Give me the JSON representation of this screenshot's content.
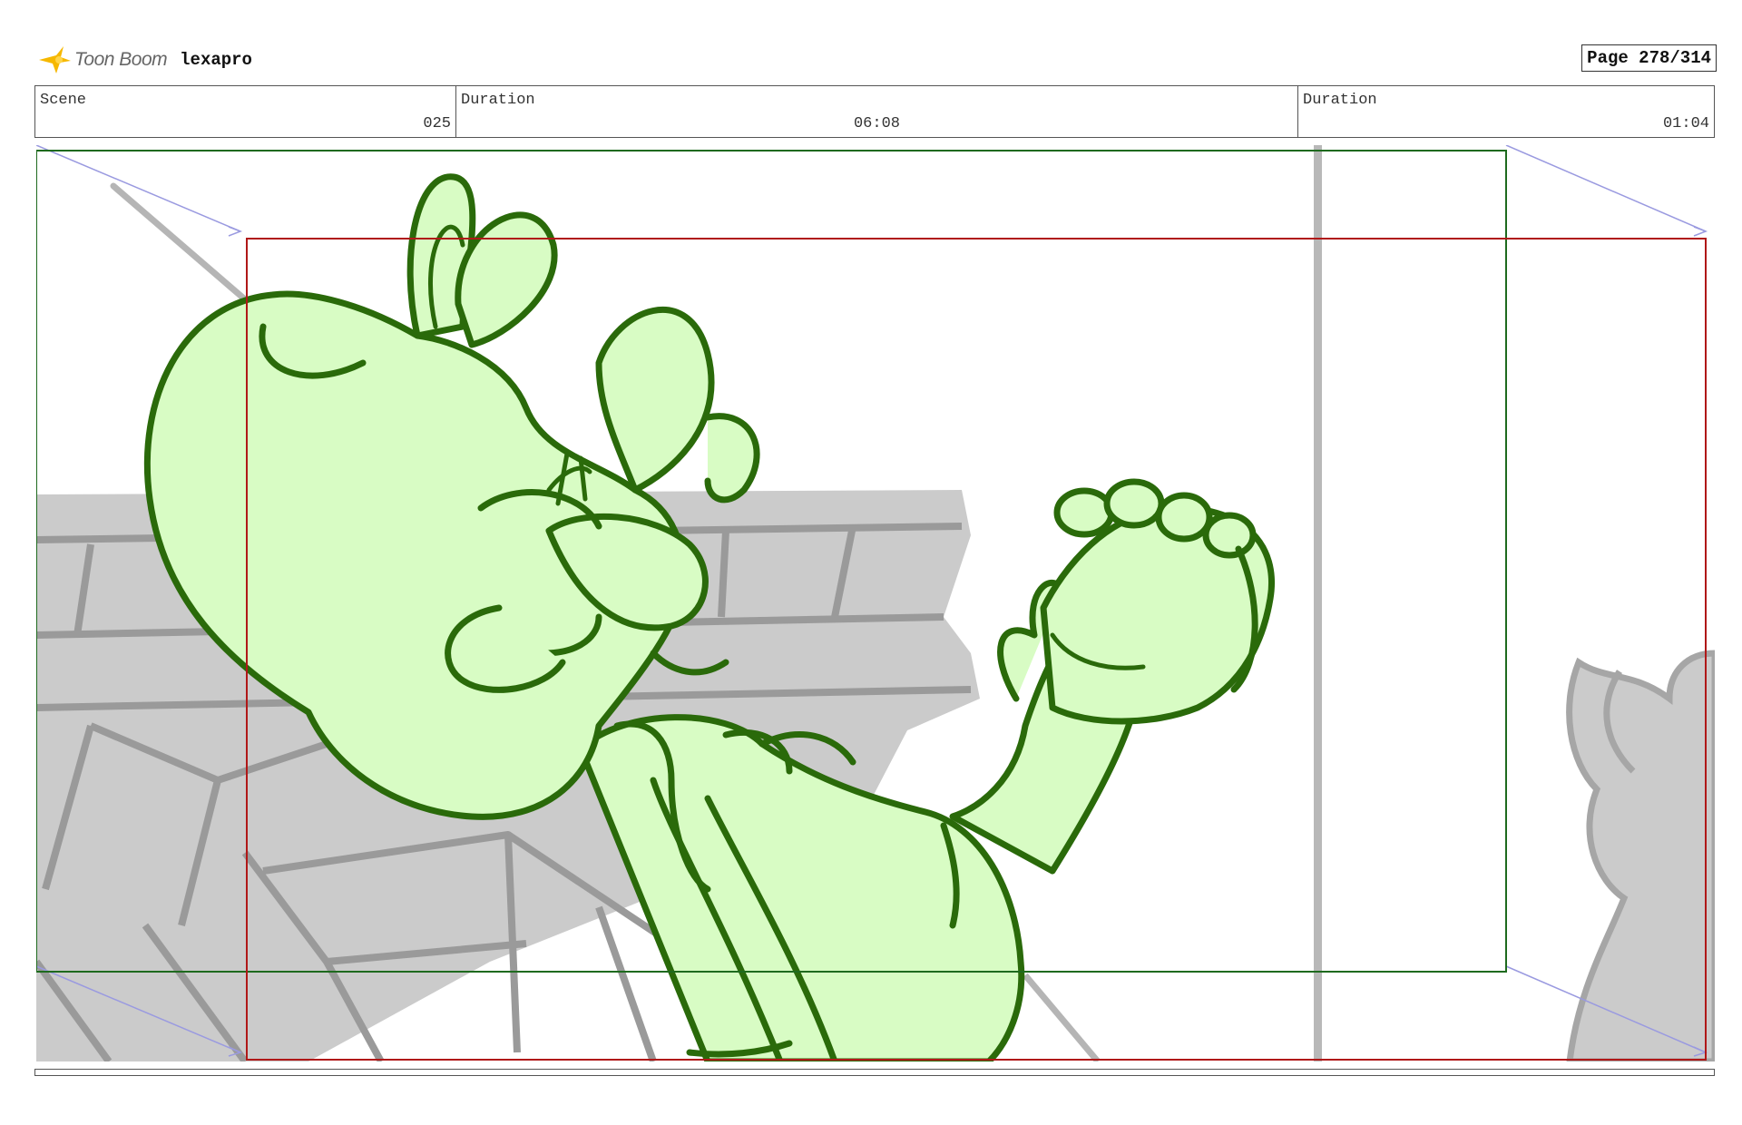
{
  "header": {
    "logo_text": "Toon Boom",
    "project": "lexapro",
    "page": "Page 278/314"
  },
  "info": {
    "scene_label": "Scene",
    "scene_value": "025",
    "duration_label": "Duration",
    "duration_value": "06:08",
    "duration2_label": "Duration",
    "duration2_value": "01:04"
  },
  "colors": {
    "character_fill": "#d8fcc4",
    "character_line": "#2a6a0a",
    "background_gray": "#cbcbcb",
    "frame_green": "#1e6a1e",
    "frame_red": "#b01818",
    "camera_guide": "#9a9ae0"
  }
}
